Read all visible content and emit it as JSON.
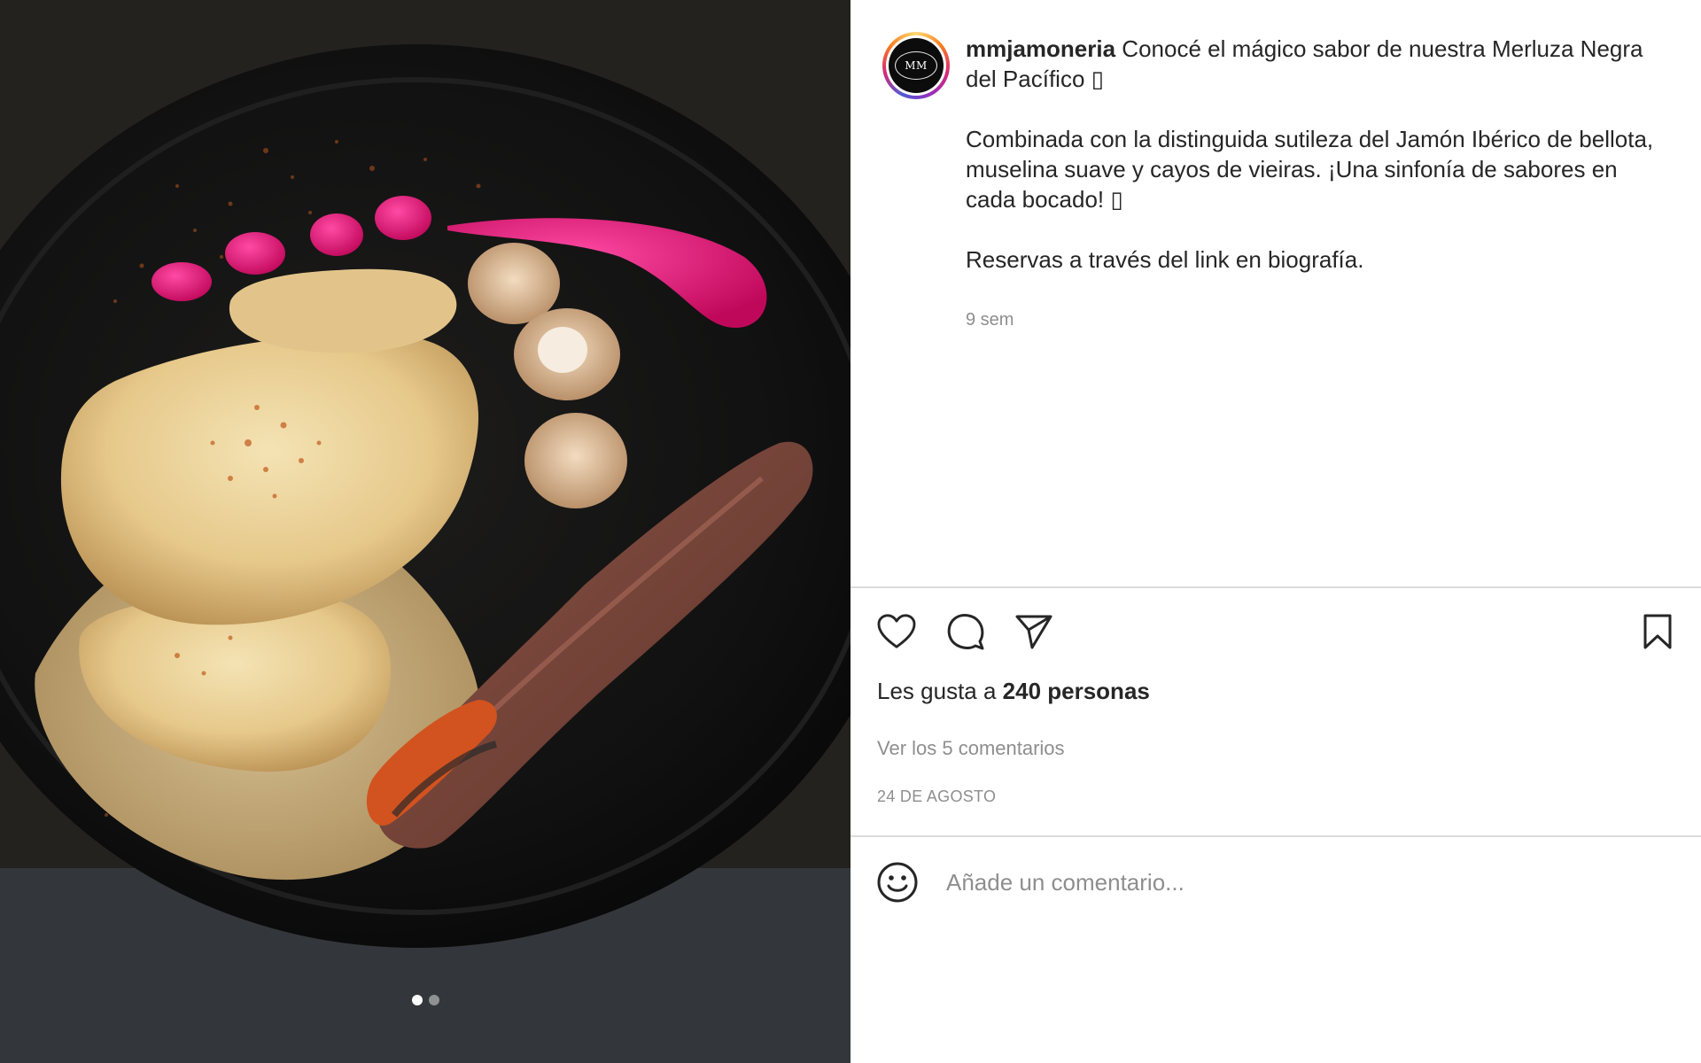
{
  "post": {
    "username": "mmjamoneria",
    "avatar_text": "MM",
    "caption_line1": " Conocé el mágico sabor de nuestra Merluza Negra del Pacífico ▯",
    "caption_paragraph2": "Combinada con la distinguida sutileza del Jamón Ibérico de bellota, muselina suave y cayos de vieiras. ¡Una sinfonía de sabores en cada bocado! ▯",
    "caption_paragraph3": "Reservas a través del link en biografía.",
    "time_ago": "9 sem"
  },
  "actions": {
    "like_icon": "heart-icon",
    "comment_icon": "comment-icon",
    "share_icon": "send-icon",
    "save_icon": "bookmark-icon"
  },
  "likes": {
    "prefix": "Les gusta a ",
    "count_text": "240 personas"
  },
  "comments": {
    "view_all": "Ver los 5 comentarios"
  },
  "date": "24 DE AGOSTO",
  "comment_input": {
    "placeholder": "Añade un comentario..."
  },
  "media": {
    "total_slides": 2,
    "active_slide": 1
  },
  "colors": {
    "text": "#262626",
    "muted": "#8e8e8e",
    "divider": "#dbdbdb",
    "beet_puree": "#e0106e"
  }
}
